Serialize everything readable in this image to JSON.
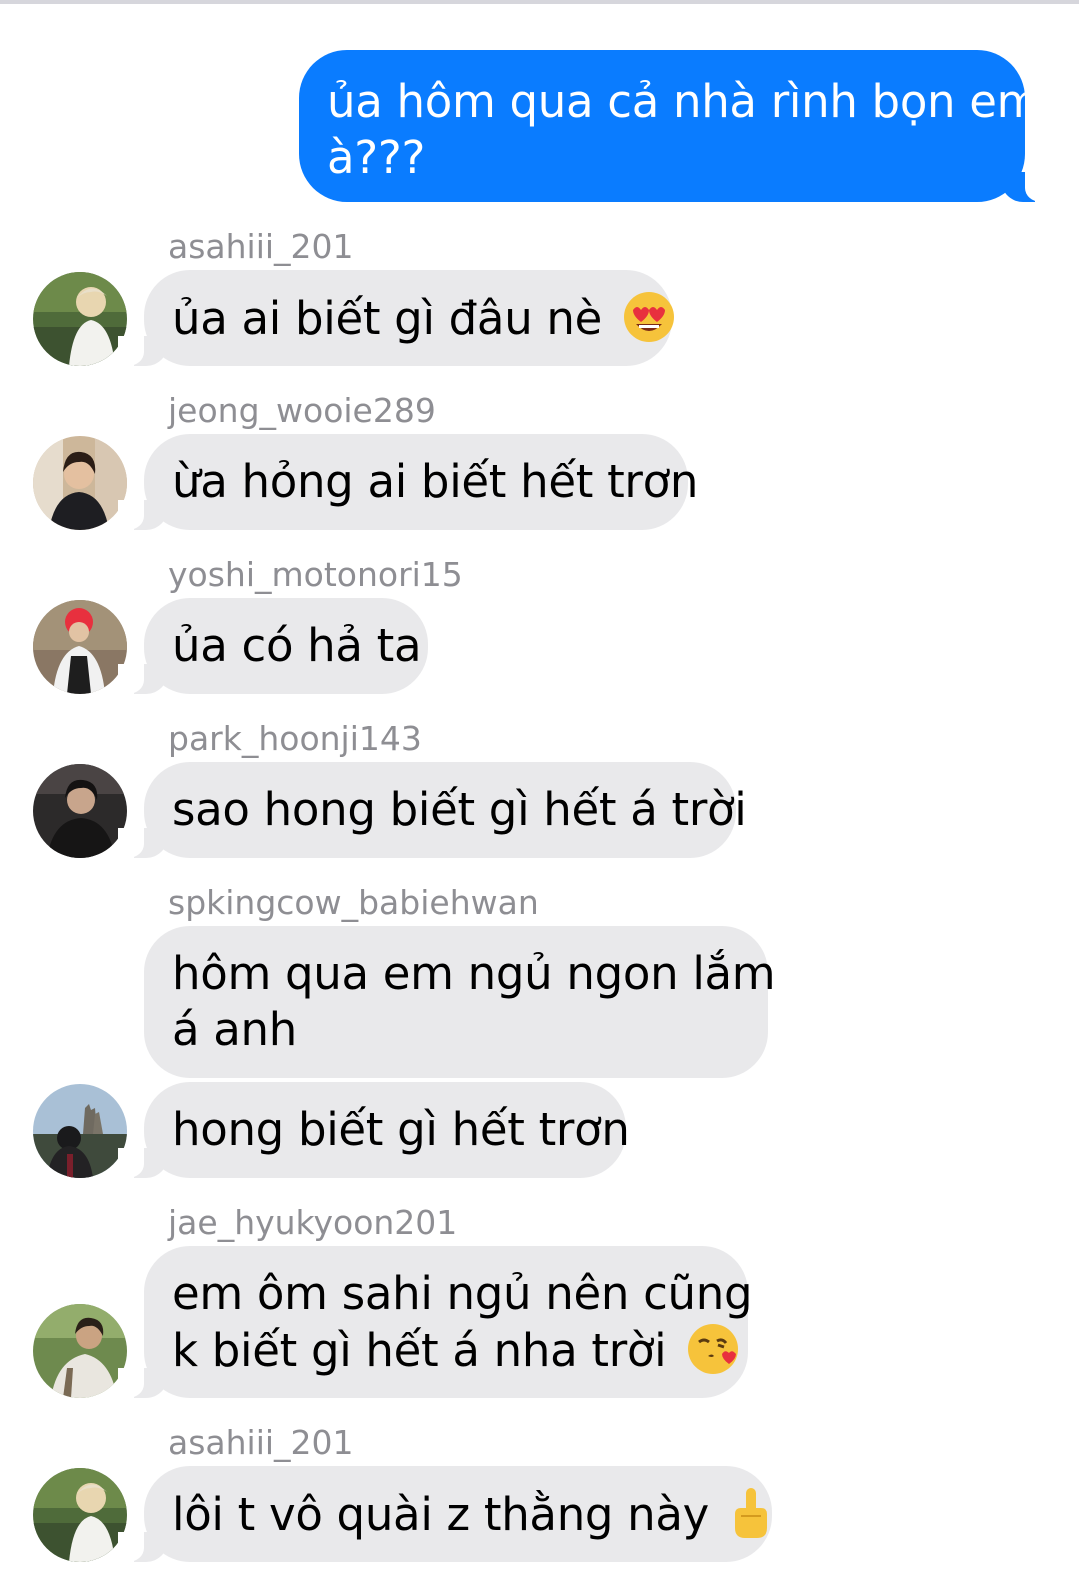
{
  "conversation": {
    "sent": {
      "line1": "ủa hôm qua cả nhà rình bọn em",
      "line2": "à???"
    },
    "messages": [
      {
        "sender": "asahiii_201",
        "text": "ủa ai biết gì đâu nè",
        "emoji": "heart-eyes-emoji"
      },
      {
        "sender": "jeong_wooie289",
        "text": "ừa hỏng ai biết hết trơn"
      },
      {
        "sender": "yoshi_motonori15",
        "text": "ủa có hả ta"
      },
      {
        "sender": "park_hoonji143",
        "text": "sao hong biết gì hết á trời"
      },
      {
        "sender": "spkingcow_babiehwan",
        "line1": "hôm qua em ngủ ngon lắm",
        "line2": "á anh",
        "followup": "hong biết gì hết trơn"
      },
      {
        "sender": "jae_hyukyoon201",
        "line1": "em ôm sahi ngủ nên cũng",
        "line2": "k biết gì hết á nha trời",
        "emoji": "face-blowing-kiss-emoji"
      },
      {
        "sender": "asahiii_201",
        "text": "lôi t vô quài z thằng này",
        "emoji": "middle-finger-emoji"
      }
    ]
  },
  "colors": {
    "sent_bubble": "#0a7cff",
    "received_bubble": "#e9e9eb",
    "sender_name": "#8e8e93"
  }
}
